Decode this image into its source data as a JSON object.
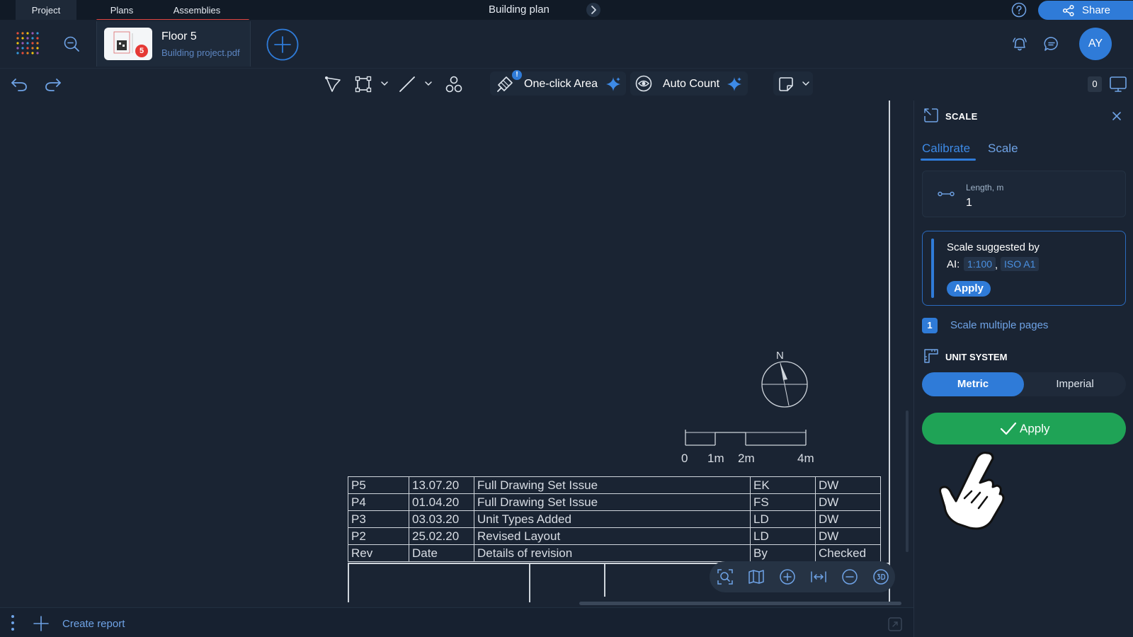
{
  "top_tabs": {
    "project": "Project",
    "plans": "Plans",
    "assemblies": "Assemblies"
  },
  "doc_title": "Building plan",
  "share": {
    "label": "Share"
  },
  "file": {
    "name": "Floor 5",
    "subtitle": "Building project.pdf",
    "badge": "5"
  },
  "user": {
    "initials": "AY"
  },
  "toolbar": {
    "oneclick_label": "One-click Area",
    "autocount_label": "Auto Count",
    "warn": "!",
    "count": "0"
  },
  "drawing": {
    "north": "N",
    "scale_ticks": [
      "0",
      "1m",
      "2m",
      "4m"
    ],
    "revisions": [
      [
        "P5",
        "13.07.20",
        "Full Drawing Set Issue",
        "EK",
        "DW"
      ],
      [
        "P4",
        "01.04.20",
        "Full Drawing Set Issue",
        "FS",
        "DW"
      ],
      [
        "P3",
        "03.03.20",
        "Unit Types Added",
        "LD",
        "DW"
      ],
      [
        "P2",
        "25.02.20",
        "Revised Layout",
        "LD",
        "DW"
      ],
      [
        "Rev",
        "Date",
        "Details of revision",
        "By",
        "Checked"
      ]
    ]
  },
  "bottom": {
    "create_report": "Create report"
  },
  "panel": {
    "title": "SCALE",
    "tabs": {
      "calibrate": "Calibrate",
      "scale": "Scale"
    },
    "length": {
      "label": "Length, m",
      "value": "1"
    },
    "suggestion": {
      "text": "Scale suggested by",
      "ai_label": "AI:",
      "scale_chip": "1:100",
      "separator": ",",
      "paper_chip": "ISO A1",
      "apply": "Apply"
    },
    "multiple": {
      "count": "1",
      "label": "Scale multiple pages"
    },
    "unit_system": {
      "title": "UNIT SYSTEM",
      "metric": "Metric",
      "imperial": "Imperial",
      "selected": "Metric"
    },
    "apply": "Apply"
  },
  "colors": {
    "accent": "#2f7bd8",
    "apply_green": "#1fa356",
    "tab_underline": "#e0433f",
    "badge_red": "#e53935"
  }
}
